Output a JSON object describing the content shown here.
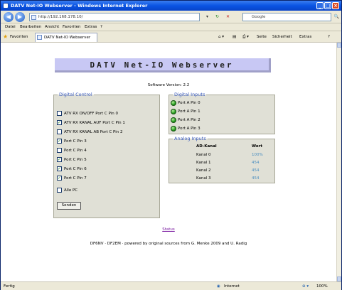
{
  "window": {
    "title": "DATV Net-IO Webserver - Windows Internet Explorer",
    "minimize": "_",
    "maximize": "□",
    "close": "×"
  },
  "address_bar": {
    "back_icon": "◀",
    "forward_icon": "▶",
    "url": "http://192.168.178.10/",
    "refresh_icon": "↻",
    "stop_icon": "✕",
    "search_placeholder": "Google",
    "search_go": "🔍"
  },
  "menu": {
    "items": [
      "Datei",
      "Bearbeiten",
      "Ansicht",
      "Favoriten",
      "Extras",
      "?"
    ]
  },
  "favorites_bar": {
    "favorites_label": "Favoriten",
    "tab_title": "DATV Net-IO Webserver",
    "tools": [
      "Seite",
      "Sicherheit",
      "Extras",
      "?"
    ]
  },
  "page": {
    "header_title": "DATV Net-IO Webserver",
    "version": "Software Version: 2.2",
    "digital_control": {
      "legend": "Digital Control",
      "rows": [
        {
          "label": "ATV RX ON/OFF Port C Pin 0",
          "checked": false
        },
        {
          "label": "ATV RX KANAL AUF Port C Pin 1",
          "checked": true
        },
        {
          "label": "ATV RX KANAL AB Port C Pin 2",
          "checked": false
        },
        {
          "label": "Port C Pin 3",
          "checked": true
        },
        {
          "label": "Port C Pin 4",
          "checked": false
        },
        {
          "label": "Port C Pin 5",
          "checked": true
        },
        {
          "label": "Port C Pin 6",
          "checked": true
        },
        {
          "label": "Port C Pin 7",
          "checked": true
        },
        {
          "label": "Alle PC",
          "checked": false
        }
      ],
      "send_button": "Senden"
    },
    "digital_inputs": {
      "legend": "Digital Inputs",
      "rows": [
        "Port A Pin 0",
        "Port A Pin 1",
        "Port A Pin 2",
        "Port A Pin 3"
      ]
    },
    "analog_inputs": {
      "legend": "Analog Inputs",
      "col_channel": "AD-Kanal",
      "col_value": "Wert",
      "rows": [
        {
          "channel": "Kanal 0",
          "value": "100%"
        },
        {
          "channel": "Kanal 1",
          "value": "454"
        },
        {
          "channel": "Kanal 2",
          "value": "454"
        },
        {
          "channel": "Kanal 3",
          "value": "454"
        }
      ]
    },
    "footer_link": "Status",
    "footer_text": "DF6NV · DF2EM · powered by original sources from G. Menke 2009 and U. Radig"
  },
  "status_bar": {
    "left": "Fertig",
    "zone": "Internet",
    "zoom": "100%"
  }
}
